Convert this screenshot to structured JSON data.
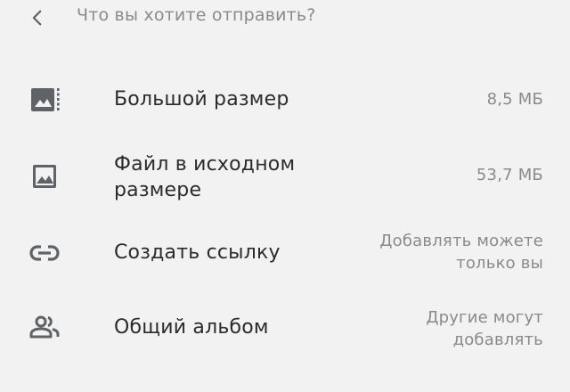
{
  "header": {
    "back_icon": "chevron-left-icon",
    "title": "Что вы хотите отправить?"
  },
  "colors": {
    "background": "#f2f2f2",
    "icon": "#5f6368",
    "label": "#2b2b2b",
    "secondary": "#8a8a8a"
  },
  "options": [
    {
      "icon": "large-photo-icon",
      "label": [
        "Большой размер"
      ],
      "meta": [
        "8,5 МБ"
      ]
    },
    {
      "icon": "image-icon",
      "label": [
        "Файл в исходном",
        "размере"
      ],
      "meta": [
        "53,7 МБ"
      ]
    },
    {
      "icon": "link-icon",
      "label": [
        "Создать ссылку"
      ],
      "meta": [
        "Добавлять можете",
        "только вы"
      ]
    },
    {
      "icon": "people-icon",
      "label": [
        "Общий альбом"
      ],
      "meta": [
        "Другие могут",
        "добавлять"
      ]
    }
  ]
}
